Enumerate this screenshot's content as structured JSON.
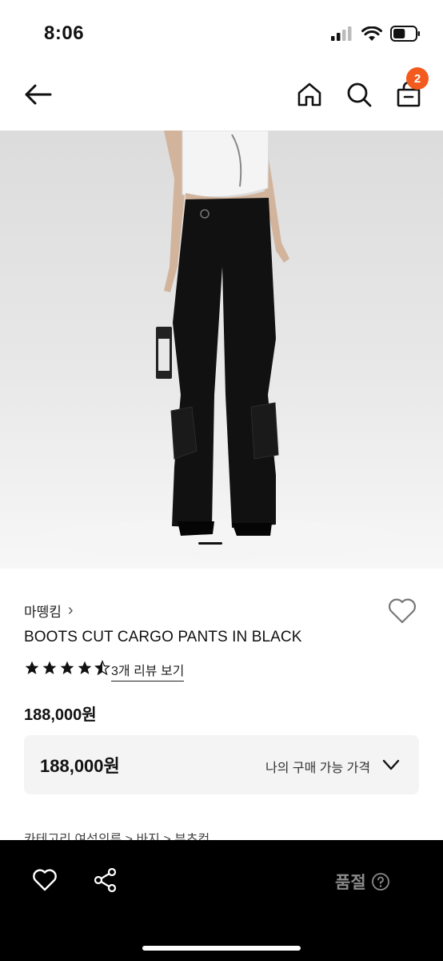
{
  "status_bar": {
    "time": "8:06",
    "battery_level": 0.55
  },
  "header": {
    "back_icon": "arrow-left-icon",
    "home_icon": "home-icon",
    "search_icon": "search-icon",
    "cart_icon": "shopping-bag-icon",
    "cart_count": "2"
  },
  "carousel": {
    "active_slide": 1
  },
  "product": {
    "brand": "마뗑킴",
    "brand_arrow": "›",
    "name": "BOOTS CUT CARGO PANTS IN BLACK",
    "rating": 4.5,
    "reviews_link": "3개 리뷰 보기",
    "price": "188,000원"
  },
  "price_box": {
    "price": "188,000원",
    "label": "나의 구매 가능 가격"
  },
  "category_line": "카테고리  여성의류 > 바지 > 부츠컷",
  "bottom_bar": {
    "like_icon": "heart-outline-icon",
    "share_icon": "share-icon",
    "status_label": "품절",
    "help_icon": "question-circle-icon"
  },
  "colors": {
    "accent": "#f35a1d",
    "bottom_bar": "#000000",
    "price_box_bg": "#f4f4f4"
  }
}
